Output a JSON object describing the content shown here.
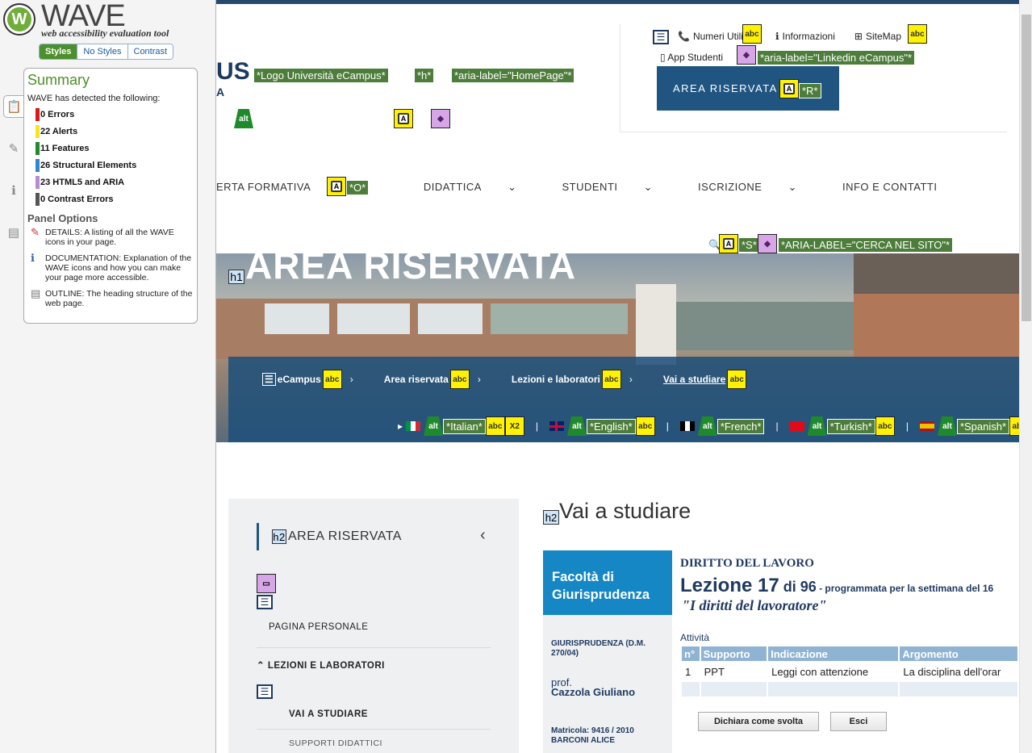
{
  "wave": {
    "title": "WAVE",
    "subtitle": "web accessibility evaluation tool",
    "toggle": [
      "Styles",
      "No Styles",
      "Contrast"
    ],
    "summary_title": "Summary",
    "detected": "WAVE has detected the following:",
    "stats": [
      {
        "label": "0 Errors",
        "color": "#d81a1a"
      },
      {
        "label": "22 Alerts",
        "color": "#f7e61c"
      },
      {
        "label": "11 Features",
        "color": "#1f8a2b"
      },
      {
        "label": "26 Structural Elements",
        "color": "#2f86d1"
      },
      {
        "label": "23 HTML5 and ARIA",
        "color": "#b88ad3"
      },
      {
        "label": "0 Contrast Errors",
        "color": "#555555"
      }
    ],
    "panel_options_title": "Panel Options",
    "options": [
      {
        "icon": "✎",
        "text": "DETAILS: A listing of all the WAVE icons in your page."
      },
      {
        "icon": "ℹ",
        "text": "DOCUMENTATION: Explanation of the WAVE icons and how you can make your page more accessible."
      },
      {
        "icon": "▤",
        "text": "OUTLINE: The heading structure of the web page."
      }
    ]
  },
  "site": {
    "logo_fragment": "US",
    "logo_fragment2": "A",
    "tags": {
      "logo": "*Logo Università eCampus*",
      "h": "*h*",
      "home": "*aria-label=\"HomePage\"*",
      "linkedin": "*aria-label=\"Linkedin eCampus\"*",
      "r": "*R*",
      "o": "*O*",
      "s": "*S*",
      "search": "*ARIA-LABEL=\"CERCA NEL SITO\"*"
    },
    "toplinks": [
      "Numeri Utili",
      "Informazioni",
      "SiteMap"
    ],
    "app_studenti": "App Studenti",
    "area_riservata_btn": "AREA RISERVATA",
    "nav": [
      "ERTA FORMATIVA",
      "DIDATTICA",
      "STUDENTI",
      "ISCRIZIONE",
      "INFO E CONTATTI"
    ],
    "hero_title": "AREA RISERVATA",
    "breadcrumbs": [
      "eCampus",
      "Area riservata",
      "Lezioni e laboratori",
      "Vai a studiare"
    ],
    "languages": [
      "*Italian*",
      "*English*",
      "*French*",
      "*Turkish*",
      "*Spanish*"
    ],
    "x2": "X2",
    "sidebar_title": "AREA RISERVATA",
    "sidebar_items": {
      "pagina": "PAGINA PERSONALE",
      "lezioni": "LEZIONI E LABORATORI",
      "vai": "VAI A STUDIARE",
      "supporti": "SUPPORTI DIDATTICI"
    },
    "page_heading": "Vai a studiare",
    "facolta": "Facoltà di Giurisprudenza",
    "corso": "GIURISPRUDENZA (D.M. 270/04)",
    "prof_label": "prof.",
    "prof_name": "Cazzola Giuliano",
    "matricola": "Matricola:  9416 / 2010",
    "studente": "BARCONI ALICE",
    "course_title": "DIRITTO DEL LAVORO",
    "lezione": "Lezione 17",
    "di": " di 96",
    "programmata": " - programmata per la settimana del 16",
    "quote": "\"I diritti del lavoratore\"",
    "attivita": "Attività",
    "table_headers": [
      "n°",
      "Supporto",
      "Indicazione",
      "Argomento"
    ],
    "table_rows": [
      [
        "1",
        "PPT",
        "Leggi con attenzione",
        "La disciplina dell'orar"
      ]
    ],
    "btn_done": "Dichiara come svolta",
    "btn_exit": "Esci"
  }
}
